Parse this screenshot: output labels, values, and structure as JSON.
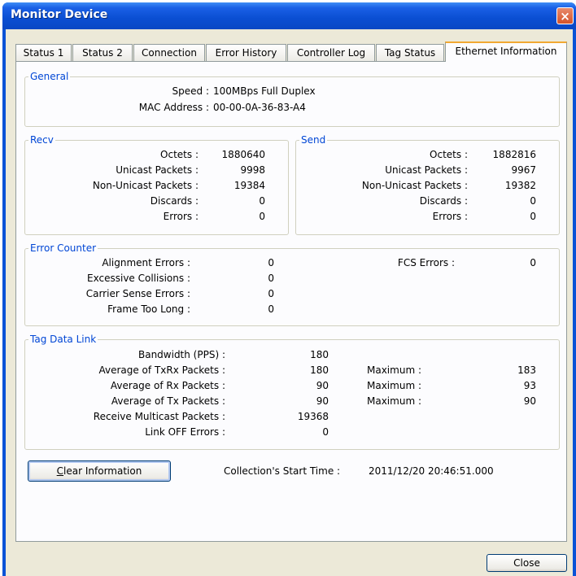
{
  "window": {
    "title": "Monitor Device",
    "close_glyph": "×"
  },
  "tabs": [
    {
      "label": "Status 1"
    },
    {
      "label": "Status 2"
    },
    {
      "label": "Connection"
    },
    {
      "label": "Error History"
    },
    {
      "label": "Controller Log"
    },
    {
      "label": "Tag Status"
    },
    {
      "label": "Ethernet Information",
      "active": true
    }
  ],
  "general": {
    "title": "General",
    "speed_label": "Speed :",
    "speed_value": "100MBps Full Duplex",
    "mac_label": "MAC Address :",
    "mac_value": "00-00-0A-36-83-A4"
  },
  "recv": {
    "title": "Recv",
    "rows": [
      {
        "label": "Octets :",
        "value": "1880640"
      },
      {
        "label": "Unicast Packets :",
        "value": "9998"
      },
      {
        "label": "Non-Unicast Packets :",
        "value": "19384"
      },
      {
        "label": "Discards :",
        "value": "0"
      },
      {
        "label": "Errors :",
        "value": "0"
      }
    ]
  },
  "send": {
    "title": "Send",
    "rows": [
      {
        "label": "Octets :",
        "value": "1882816"
      },
      {
        "label": "Unicast Packets :",
        "value": "9967"
      },
      {
        "label": "Non-Unicast Packets :",
        "value": "19382"
      },
      {
        "label": "Discards :",
        "value": "0"
      },
      {
        "label": "Errors :",
        "value": "0"
      }
    ]
  },
  "error_counter": {
    "title": "Error Counter",
    "rows": [
      {
        "label": "Alignment Errors :",
        "value": "0"
      },
      {
        "label": "Excessive Collisions :",
        "value": "0"
      },
      {
        "label": "Carrier Sense Errors :",
        "value": "0"
      },
      {
        "label": "Frame Too Long :",
        "value": "0"
      }
    ],
    "fcs_label": "FCS Errors :",
    "fcs_value": "0"
  },
  "tag_data_link": {
    "title": "Tag Data Link",
    "rows": [
      {
        "label": "Bandwidth (PPS) :",
        "value": "180"
      },
      {
        "label": "Average of TxRx Packets :",
        "value": "180",
        "max_label": "Maximum :",
        "max_value": "183"
      },
      {
        "label": "Average of Rx Packets :",
        "value": "90",
        "max_label": "Maximum :",
        "max_value": "93"
      },
      {
        "label": "Average of Tx Packets :",
        "value": "90",
        "max_label": "Maximum :",
        "max_value": "90"
      },
      {
        "label": "Receive Multicast Packets :",
        "value": "19368"
      },
      {
        "label": "Link OFF Errors :",
        "value": "0"
      }
    ]
  },
  "actions": {
    "clear_mnemonic": "C",
    "clear_rest": "lear Information",
    "start_time_label": "Collection's Start Time :",
    "start_time_value": "2011/12/20 20:46:51.000",
    "close_label": "Close"
  }
}
